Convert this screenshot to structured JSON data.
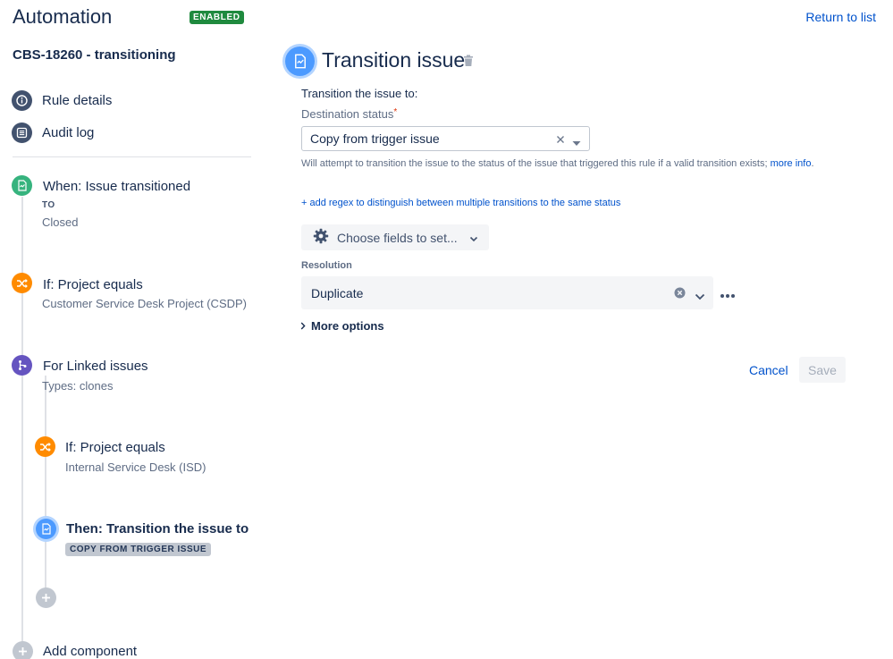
{
  "header": {
    "app_title": "Automation",
    "status_badge": "ENABLED",
    "return_link": "Return to list",
    "rule_name": "CBS-18260 - transitioning"
  },
  "sidebar": {
    "nav": [
      {
        "label": "Rule details",
        "icon": "info-icon"
      },
      {
        "label": "Audit log",
        "icon": "list-icon"
      }
    ],
    "timeline": {
      "trigger": {
        "title": "When: Issue transitioned",
        "to_label": "TO",
        "to_value": "Closed",
        "icon": "transition-icon"
      },
      "condition1": {
        "title": "If: Project equals",
        "subtitle": "Customer Service Desk Project (CSDP)",
        "icon": "shuffle-icon"
      },
      "branch": {
        "title": "For Linked issues",
        "subtitle": "Types: clones",
        "icon": "branch-icon"
      },
      "condition2": {
        "title": "If: Project equals",
        "subtitle": "Internal Service Desk (ISD)",
        "icon": "shuffle-icon"
      },
      "action": {
        "title": "Then: Transition the issue to",
        "lozenge": "COPY FROM TRIGGER ISSUE",
        "icon": "transition-icon"
      },
      "add_component": "Add component"
    }
  },
  "main": {
    "title": "Transition issue",
    "transition_label": "Transition the issue to:",
    "destination_label": "Destination status",
    "required_marker": "*",
    "destination_value": "Copy from trigger issue",
    "help_text": "Will attempt to transition the issue to the status of the issue that triggered this rule if a valid transition exists;",
    "help_link": "more info",
    "help_suffix": ".",
    "regex_link": "+ add regex to distinguish between multiple transitions to the same status",
    "choose_fields": "Choose fields to set...",
    "resolution_label": "Resolution",
    "resolution_value": "Duplicate",
    "more_options": "More options",
    "cancel": "Cancel",
    "save": "Save"
  },
  "colors": {
    "accent": "#0052cc",
    "badge_green": "#1f8a3e",
    "trigger_green": "#36b37e",
    "condition_orange": "#ff8b00",
    "branch_purple": "#6554c0",
    "action_blue": "#4c9aff"
  }
}
